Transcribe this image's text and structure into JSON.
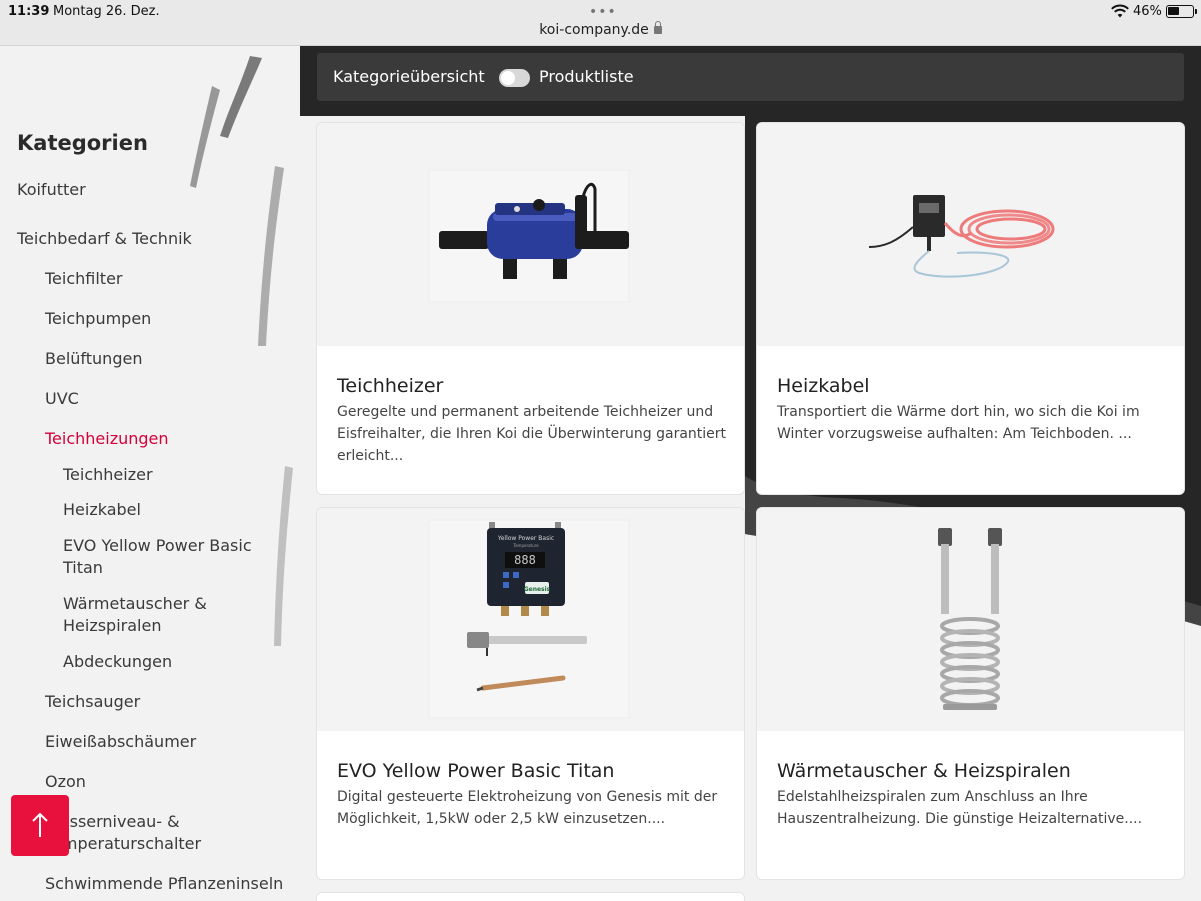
{
  "status": {
    "time": "11:39",
    "date": "Montag 26. Dez.",
    "battery": "46%",
    "battery_level": 0.46,
    "url": "koi-company.de"
  },
  "sidebar": {
    "title": "Kategorien",
    "items": [
      {
        "label": "Koifutter"
      },
      {
        "label": "Teichbedarf & Technik"
      },
      {
        "label": "Teichfilter"
      },
      {
        "label": "Teichpumpen"
      },
      {
        "label": "Belüftungen"
      },
      {
        "label": "UVC"
      },
      {
        "label": "Teichheizungen"
      },
      {
        "label": "Teichheizer"
      },
      {
        "label": "Heizkabel"
      },
      {
        "label": "EVO Yellow Power Basic Titan"
      },
      {
        "label": "Wärmetauscher & Heizspiralen"
      },
      {
        "label": "Abdeckungen"
      },
      {
        "label": "Teichsauger"
      },
      {
        "label": "Eiweißabschäumer"
      },
      {
        "label": "Ozon"
      },
      {
        "label": "Wasserniveau- & Temperaturschalter"
      },
      {
        "label": "Schwimmende Pflanzeninseln"
      }
    ]
  },
  "view_toggle": {
    "left_label": "Kategorieübersicht",
    "right_label": "Produktliste"
  },
  "cards": [
    {
      "title": "Teichheizer",
      "desc": "Geregelte und permanent arbeitende Teichheizer und Eisfreihalter, die Ihren Koi die Überwinterung garantiert erleicht..."
    },
    {
      "title": "Heizkabel",
      "desc": "Transportiert die Wärme dort hin, wo sich die Koi im Winter vorzugsweise aufhalten: Am Teichboden.  ..."
    },
    {
      "title": "EVO Yellow Power Basic Titan",
      "desc": "Digital gesteuerte Elektroheizung von Genesis mit der Möglichkeit, 1,5kW oder 2,5 kW einzusetzen...."
    },
    {
      "title": "Wärmetauscher & Heizspiralen",
      "desc": "Edelstahlheizspiralen zum Anschluss an Ihre Hauszentralheizung. Die günstige Heizalternative...."
    }
  ],
  "controller_texts": {
    "brand": "Yellow Power Basic",
    "sub": "Temperature",
    "digits": "888",
    "logo": "Genesis"
  },
  "colors": {
    "accent": "#d4003a",
    "scroll_button": "#e8103c",
    "toggle_bar": "#3a3a3a"
  },
  "icons": {
    "scroll_top": "arrow-up-icon",
    "lock": "lock-icon",
    "wifi": "wifi-icon"
  }
}
